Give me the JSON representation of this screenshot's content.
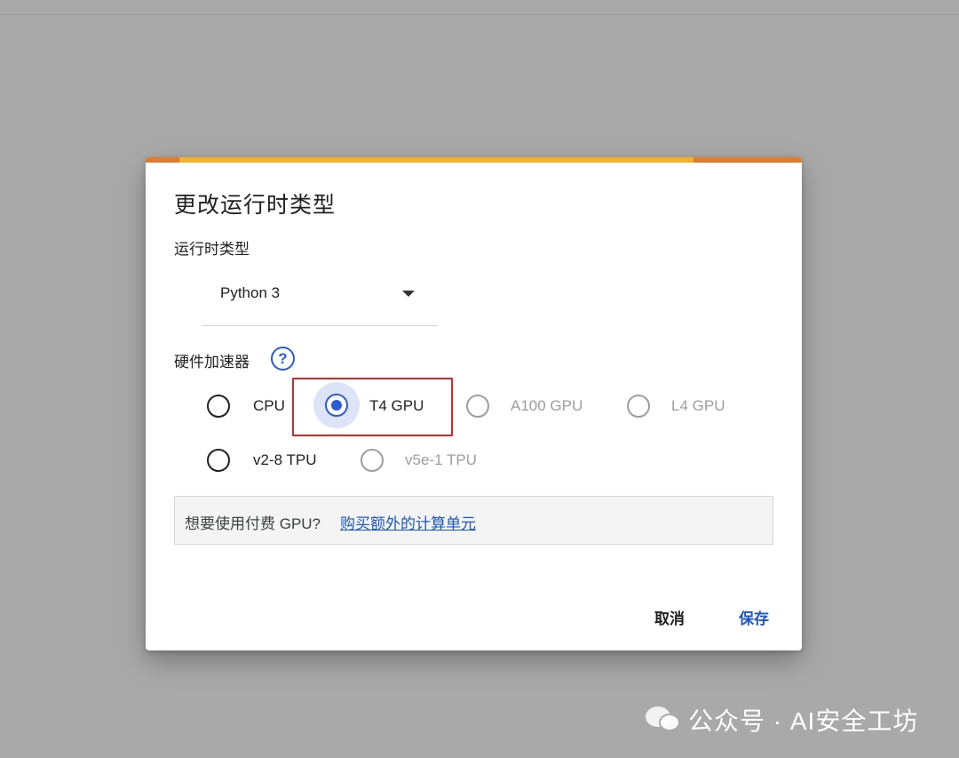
{
  "dialog": {
    "title": "更改运行时类型",
    "runtime_label": "运行时类型",
    "runtime_value": "Python 3",
    "hardware_label": "硬件加速器",
    "help_symbol": "?",
    "accelerators": [
      {
        "label": "CPU",
        "selected": false,
        "disabled": false
      },
      {
        "label": "T4 GPU",
        "selected": true,
        "disabled": false
      },
      {
        "label": "A100 GPU",
        "selected": false,
        "disabled": true
      },
      {
        "label": "L4 GPU",
        "selected": false,
        "disabled": true
      },
      {
        "label": "v2-8 TPU",
        "selected": false,
        "disabled": false
      },
      {
        "label": "v5e-1 TPU",
        "selected": false,
        "disabled": true
      }
    ],
    "notice_text": "想要使用付费 GPU?",
    "notice_link": "购买额外的计算单元",
    "cancel_label": "取消",
    "save_label": "保存"
  },
  "watermark": {
    "text": "公众号 · AI安全工坊",
    "icon": "wechat-icon"
  },
  "colors": {
    "accent": "#2a5bd7",
    "highlight": "#e0241f",
    "progress": "#f5b125",
    "progress_edge": "#e37b2c"
  }
}
